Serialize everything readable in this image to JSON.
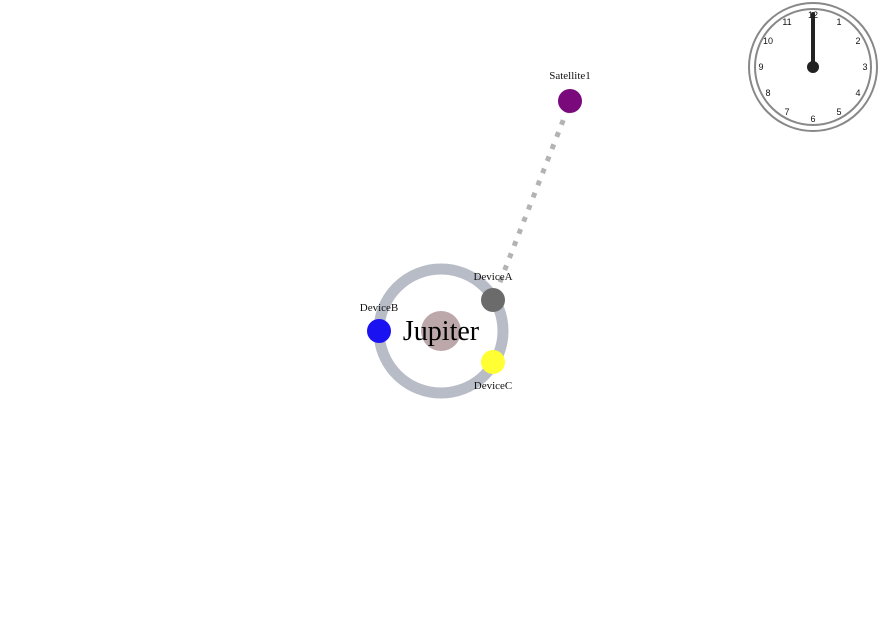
{
  "planet": {
    "name": "Jupiter",
    "color": "#bca7aa",
    "orbit_color": "#b7bcc7"
  },
  "satellite": {
    "name": "Satellite1",
    "color": "#7a0a7c"
  },
  "link": {
    "color": "#b3b3b3",
    "style": "dotted",
    "from": "Satellite1",
    "to": "DeviceA"
  },
  "devices": [
    {
      "name": "DeviceA",
      "color": "#6b6b6b"
    },
    {
      "name": "DeviceB",
      "color": "#1a12f0"
    },
    {
      "name": "DeviceC",
      "color": "#ffff33"
    }
  ],
  "clock": {
    "numbers": [
      "12",
      "1",
      "2",
      "3",
      "4",
      "5",
      "6",
      "7",
      "8",
      "9",
      "10",
      "11"
    ],
    "time": "12:00",
    "face_color": "#ffffff",
    "rim_color": "#888888",
    "hand_color": "#222222"
  }
}
